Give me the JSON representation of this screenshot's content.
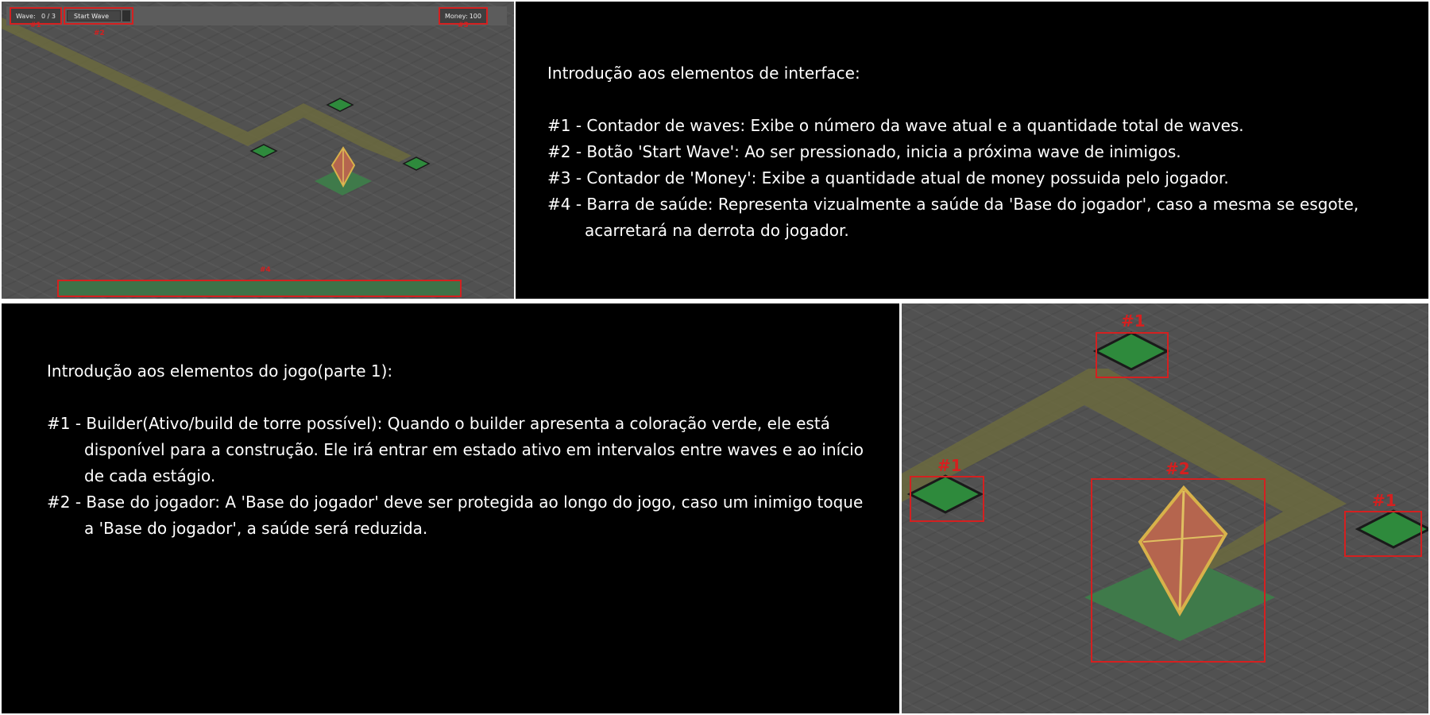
{
  "hud": {
    "wave_label": "Wave:",
    "wave_value": "0 / 3",
    "start_wave_label": "Start Wave",
    "money_label": "Money:",
    "money_value": "100",
    "health_fraction": 1.0
  },
  "callouts_ui": [
    "#1",
    "#2",
    "#3",
    "#4"
  ],
  "ui_intro": {
    "title": "Introdução aos elementos de interface:",
    "items": [
      "#1 - Contador de waves: Exibe o número da wave atual e a quantidade total de waves.",
      "#2 - Botão 'Start Wave': Ao ser pressionado, inicia a próxima wave de inimigos.",
      "#3 - Contador de 'Money': Exibe a quantidade atual de money possuida pelo jogador.",
      "#4 - Barra de saúde: Representa vizualmente a saúde da 'Base do jogador', caso a mesma se esgote, acarretará na derrota do jogador."
    ]
  },
  "game_intro": {
    "title": "Introdução aos elementos do jogo(parte 1):",
    "items": [
      "#1 - Builder(Ativo/build de torre possível): Quando o builder apresenta a coloração verde, ele está disponível para a construção. Ele irá entrar em estado ativo em intervalos entre waves e ao início de cada estágio.",
      "#2 - Base do jogador: A 'Base do jogador' deve ser protegida ao longo do jogo, caso um inimigo toque a 'Base do jogador', a saúde será reduzida."
    ]
  },
  "callouts_game": [
    "#1",
    "#1",
    "#2",
    "#1"
  ],
  "colors": {
    "accent_red": "#d42020",
    "ground": "#515151",
    "path": "#6b6a3e",
    "builder": "#2e8a3c",
    "base_tile": "#3f7a4a",
    "health": "#3d6a44"
  }
}
